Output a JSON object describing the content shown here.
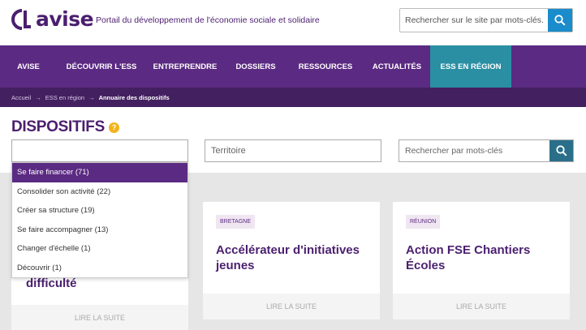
{
  "header": {
    "logo_text": "avise",
    "tagline": "Portail du développement de l'économie sociale et solidaire",
    "search_placeholder": "Rechercher sur le site par mots-clés."
  },
  "nav": {
    "items": [
      {
        "label": "AVISE"
      },
      {
        "label": "DÉCOUVRIR L'ESS"
      },
      {
        "label": "ENTREPRENDRE"
      },
      {
        "label": "DOSSIERS"
      },
      {
        "label": "RESSOURCES"
      },
      {
        "label": "ACTUALITÉS"
      },
      {
        "label": "ESS EN RÉGION",
        "active": true
      }
    ]
  },
  "breadcrumb": {
    "items": [
      "Accueil",
      "ESS en région",
      "Annuaire des dispositifs"
    ]
  },
  "page": {
    "title": "DISPOSITIFS",
    "help_glyph": "?"
  },
  "filters": {
    "type_value": "",
    "territoire_placeholder": "Territoire",
    "keywords_placeholder": "Rechercher par mots-clés"
  },
  "dropdown": {
    "options": [
      {
        "label": "Se faire financer (71)",
        "selected": true
      },
      {
        "label": "Consolider son activité (22)"
      },
      {
        "label": "Créer sa structure (19)"
      },
      {
        "label": "Se faire accompagner (13)"
      },
      {
        "label": "Changer d'échelle (1)"
      },
      {
        "label": "Découvrir (1)"
      }
    ]
  },
  "cards": [
    {
      "tag": "",
      "title": "difficulté",
      "read_more": "LIRE LA SUITE"
    },
    {
      "tag": "BRETAGNE",
      "title": "Accélérateur d'initiatives jeunes",
      "read_more": "LIRE LA SUITE"
    },
    {
      "tag": "RÉUNION",
      "title": "Action FSE Chantiers Écoles",
      "read_more": "LIRE LA SUITE"
    }
  ],
  "colors": {
    "brand_purple": "#5b2a82",
    "brand_dark": "#43205f",
    "active_nav": "#2a8fa3",
    "search_blue": "#1a8ccb",
    "help_yellow": "#f2b31b"
  }
}
